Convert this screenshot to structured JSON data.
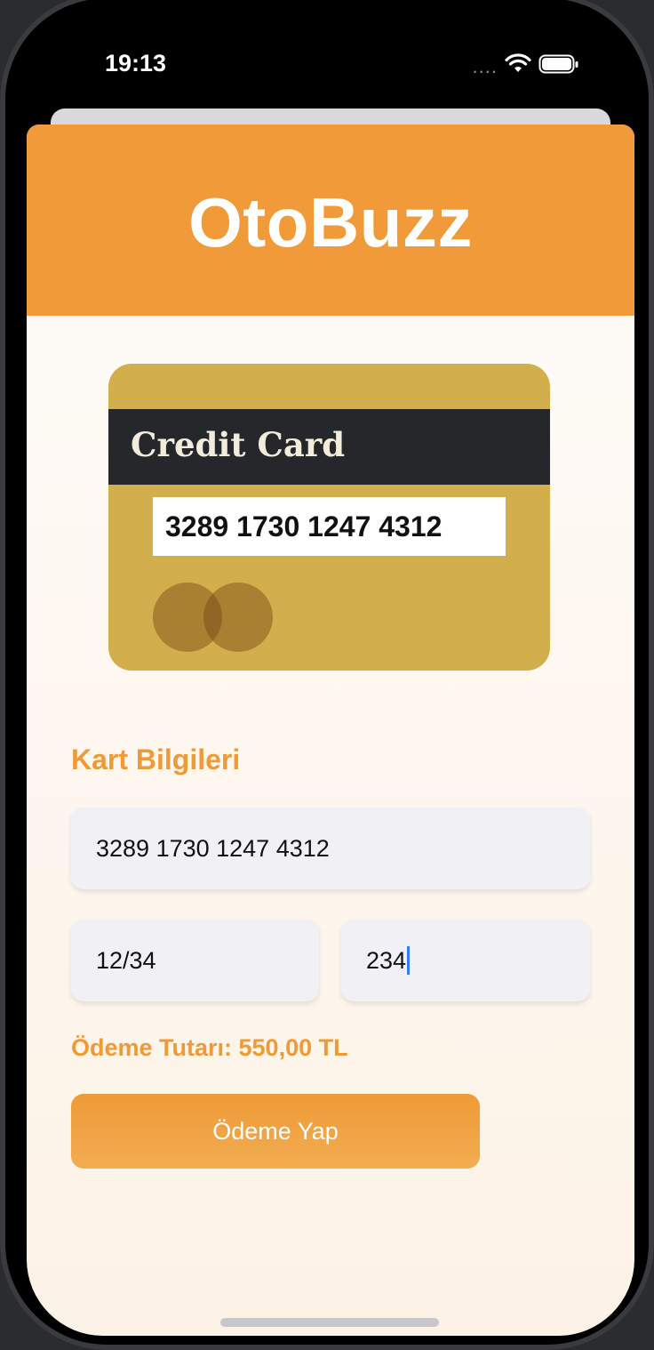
{
  "status_bar": {
    "time": "19:13",
    "signal": "....",
    "wifi_icon": "wifi-icon",
    "battery_icon": "battery-icon"
  },
  "header": {
    "title": "OtoBuzz",
    "background_color": "#f19a3a"
  },
  "card_image": {
    "label": "Credit Card",
    "number": "3289 1730 1247 4312"
  },
  "form": {
    "section_title": "Kart Bilgileri",
    "card_number_value": "3289 1730 1247 4312",
    "expiry_value": "12/34",
    "cvv_value": "234"
  },
  "payment": {
    "amount_text": "Ödeme Tutarı: 550,00 TL",
    "pay_button_label": "Ödeme Yap"
  },
  "colors": {
    "accent": "#ef9a36",
    "card_gold": "#d2ae4c",
    "field_bg": "#f1f0f5"
  }
}
